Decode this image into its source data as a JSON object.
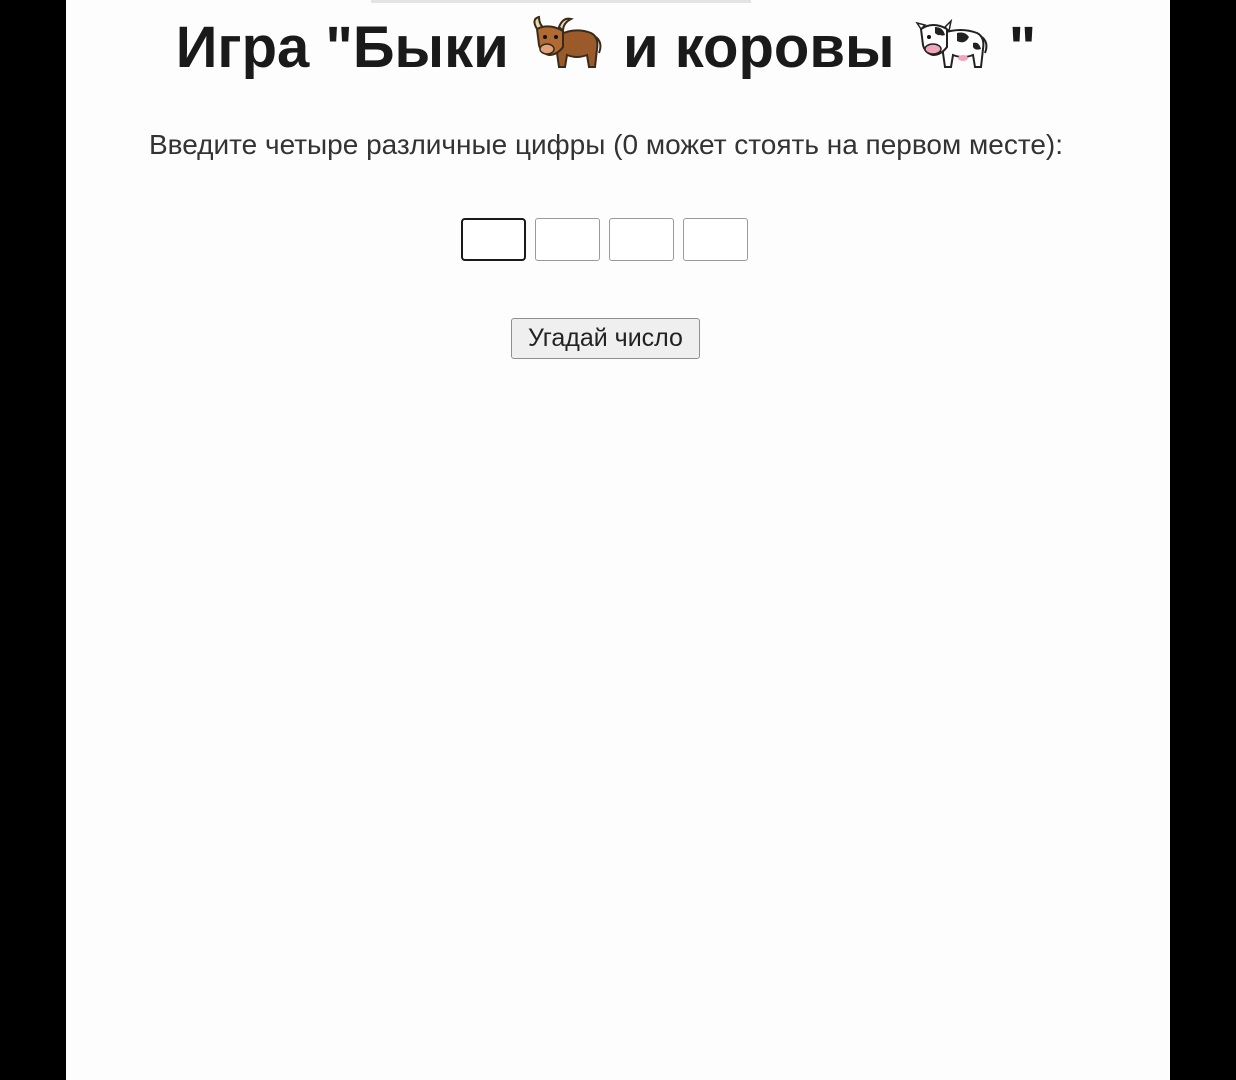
{
  "game": {
    "title_prefix": "Игра \"Быки",
    "title_middle": "и коровы",
    "title_suffix": "\"",
    "bull_emoji": "bull-icon",
    "cow_emoji": "cow-icon",
    "instruction": "Введите четыре различные цифры (0 может стоять на первом месте):",
    "digit_inputs": [
      {
        "value": ""
      },
      {
        "value": ""
      },
      {
        "value": ""
      },
      {
        "value": ""
      }
    ],
    "guess_button_label": "Угадай число"
  },
  "colors": {
    "page_background": "#fdfdfd",
    "side_background": "#000000",
    "text": "#1a1a1a"
  }
}
